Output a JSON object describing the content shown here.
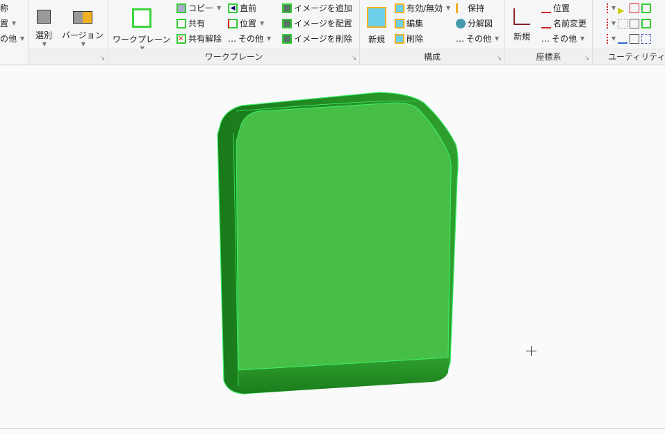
{
  "ribbon": {
    "group0": {
      "items": [
        "称",
        "置",
        "の他"
      ]
    },
    "group1": {
      "buttons": [
        "選別",
        "バージョン"
      ]
    },
    "workplane": {
      "label": "ワークプレーン",
      "big": "ワークプレーン",
      "col1": [
        "コピー",
        "共有",
        "共有解除"
      ],
      "col2": [
        "直前",
        "位置",
        "その他"
      ],
      "col3": [
        "イメージを追加",
        "イメージを配置",
        "イメージを削除"
      ]
    },
    "config": {
      "label": "構成",
      "big": "新規",
      "col1": [
        "有効/無効",
        "編集",
        "削除"
      ],
      "col2": [
        "保持",
        "分解図",
        "その他"
      ]
    },
    "coord": {
      "label": "座標系",
      "big": "新規",
      "col1": [
        "位置",
        "名前変更",
        "その他"
      ]
    },
    "utility": {
      "label": "ユーティリティ"
    }
  },
  "colors": {
    "part_face": "#47bf47",
    "part_side": "#1f8a1f",
    "edge": "#3df06a"
  }
}
